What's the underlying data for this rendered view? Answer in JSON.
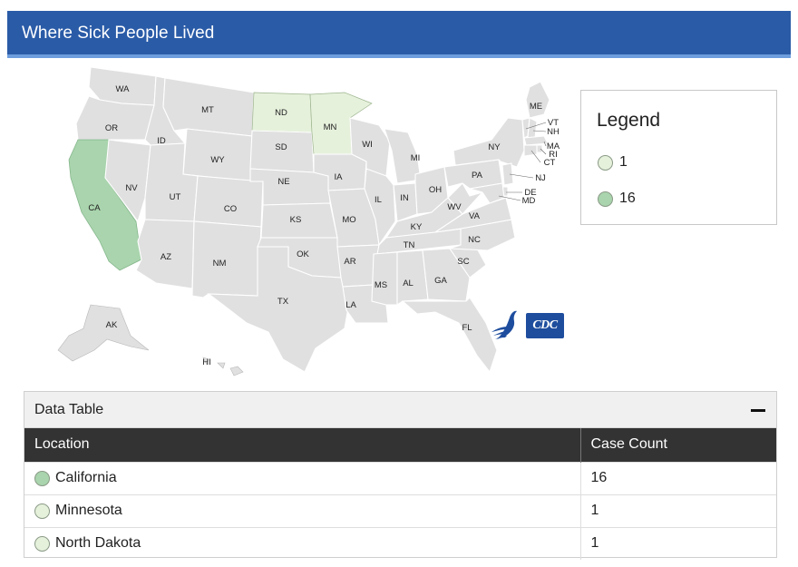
{
  "header": {
    "title": "Where Sick People Lived"
  },
  "colors": {
    "header_bg": "#2a5ba7",
    "no_cases": "#e0e0e0",
    "scale_1": "#e6f1dc",
    "scale_16": "#a9d4ad"
  },
  "map": {
    "states": [
      {
        "abbr": "WA",
        "cases": 0
      },
      {
        "abbr": "OR",
        "cases": 0
      },
      {
        "abbr": "CA",
        "cases": 16
      },
      {
        "abbr": "NV",
        "cases": 0
      },
      {
        "abbr": "ID",
        "cases": 0
      },
      {
        "abbr": "MT",
        "cases": 0
      },
      {
        "abbr": "WY",
        "cases": 0
      },
      {
        "abbr": "UT",
        "cases": 0
      },
      {
        "abbr": "AZ",
        "cases": 0
      },
      {
        "abbr": "CO",
        "cases": 0
      },
      {
        "abbr": "NM",
        "cases": 0
      },
      {
        "abbr": "ND",
        "cases": 1
      },
      {
        "abbr": "SD",
        "cases": 0
      },
      {
        "abbr": "NE",
        "cases": 0
      },
      {
        "abbr": "KS",
        "cases": 0
      },
      {
        "abbr": "OK",
        "cases": 0
      },
      {
        "abbr": "TX",
        "cases": 0
      },
      {
        "abbr": "MN",
        "cases": 1
      },
      {
        "abbr": "IA",
        "cases": 0
      },
      {
        "abbr": "MO",
        "cases": 0
      },
      {
        "abbr": "AR",
        "cases": 0
      },
      {
        "abbr": "LA",
        "cases": 0
      },
      {
        "abbr": "WI",
        "cases": 0
      },
      {
        "abbr": "IL",
        "cases": 0
      },
      {
        "abbr": "MI",
        "cases": 0
      },
      {
        "abbr": "IN",
        "cases": 0
      },
      {
        "abbr": "OH",
        "cases": 0
      },
      {
        "abbr": "KY",
        "cases": 0
      },
      {
        "abbr": "TN",
        "cases": 0
      },
      {
        "abbr": "MS",
        "cases": 0
      },
      {
        "abbr": "AL",
        "cases": 0
      },
      {
        "abbr": "GA",
        "cases": 0
      },
      {
        "abbr": "FL",
        "cases": 0
      },
      {
        "abbr": "SC",
        "cases": 0
      },
      {
        "abbr": "NC",
        "cases": 0
      },
      {
        "abbr": "VA",
        "cases": 0
      },
      {
        "abbr": "WV",
        "cases": 0
      },
      {
        "abbr": "PA",
        "cases": 0
      },
      {
        "abbr": "NY",
        "cases": 0
      },
      {
        "abbr": "ME",
        "cases": 0
      },
      {
        "abbr": "VT",
        "cases": 0
      },
      {
        "abbr": "NH",
        "cases": 0
      },
      {
        "abbr": "MA",
        "cases": 0
      },
      {
        "abbr": "RI",
        "cases": 0
      },
      {
        "abbr": "CT",
        "cases": 0
      },
      {
        "abbr": "NJ",
        "cases": 0
      },
      {
        "abbr": "DE",
        "cases": 0
      },
      {
        "abbr": "MD",
        "cases": 0
      },
      {
        "abbr": "AK",
        "cases": 0
      },
      {
        "abbr": "HI",
        "cases": 0
      }
    ],
    "logos": [
      "hhs-eagle-icon",
      "cdc-logo"
    ],
    "cdc_logo_text": "CDC"
  },
  "legend": {
    "title": "Legend",
    "items": [
      {
        "label": "1",
        "color": "#e6f1dc"
      },
      {
        "label": "16",
        "color": "#a9d4ad"
      }
    ]
  },
  "table": {
    "title": "Data Table",
    "collapse_icon": "minus-icon",
    "columns": [
      "Location",
      "Case Count"
    ],
    "rows": [
      {
        "location": "California",
        "count": "16",
        "color": "#a9d4ad"
      },
      {
        "location": "Minnesota",
        "count": "1",
        "color": "#e6f1dc"
      },
      {
        "location": "North Dakota",
        "count": "1",
        "color": "#e6f1dc"
      }
    ]
  }
}
